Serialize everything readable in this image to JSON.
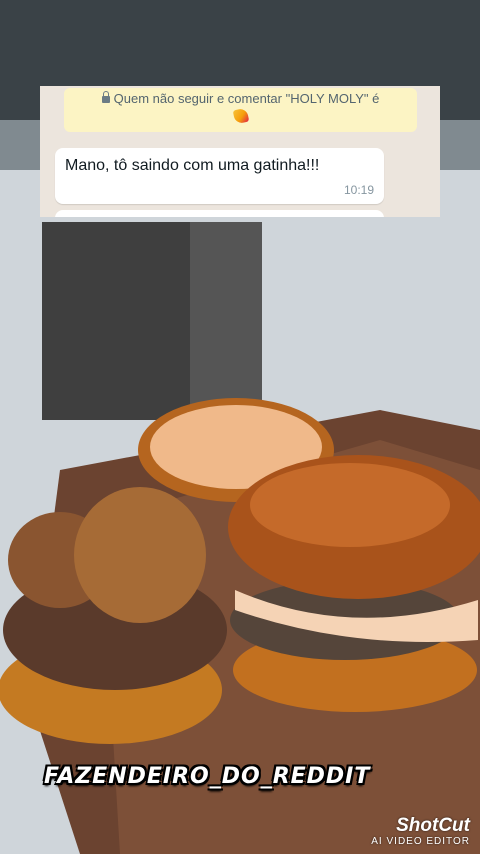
{
  "chat": {
    "system_message": "Quem não seguir e comentar \"HOLY MOLY\" é",
    "system_icon": "lock-icon",
    "system_emoji": "party-popper-icon",
    "message_text": "Mano, tô saindo com uma gatinha!!!",
    "message_time": "10:19",
    "colors": {
      "panel_bg": "#ece5dd",
      "system_bg": "#fcf4c4",
      "bubble_bg": "#ffffff"
    }
  },
  "watermark": {
    "text": "FAZENDEIRO_DO_REDDIT"
  },
  "brand": {
    "name": "ShotCut",
    "subtitle": "AI VIDEO EDITOR"
  }
}
